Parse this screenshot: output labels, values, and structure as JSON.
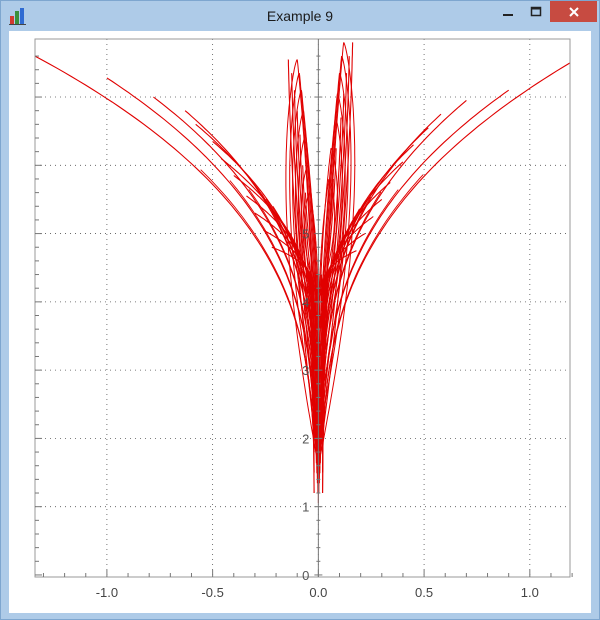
{
  "window": {
    "title": "Example 9",
    "controls": [
      "minimize",
      "maximize",
      "close"
    ],
    "icon": "bar-chart-icon",
    "close_color": "#c74b41",
    "frame_color": "#aecbe8"
  },
  "chart_data": {
    "type": "line",
    "title": "",
    "xlabel": "",
    "ylabel": "",
    "xlim": [
      -1.34,
      1.19
    ],
    "ylim": [
      -0.03,
      7.85
    ],
    "x_ticks": [
      -1.0,
      -0.5,
      0.0,
      0.5,
      1.0
    ],
    "x_tick_labels": [
      "-1.0",
      "-0.5",
      "0.0",
      "0.5",
      "1.0"
    ],
    "y_ticks": [
      0,
      1,
      2,
      3,
      4,
      5
    ],
    "y_tick_labels": [
      "0",
      "1",
      "2",
      "3",
      "4",
      "5"
    ],
    "grid": true,
    "grid_style": "dotted",
    "line_color": "#e00000",
    "curve_family": {
      "outer_branches": [
        {
          "tip": [
            -1.34,
            7.6
          ],
          "base": [
            -0.02,
            1.2
          ]
        },
        {
          "tip": [
            -1.0,
            7.28
          ],
          "base": [
            -0.02,
            1.5
          ]
        },
        {
          "tip": [
            -0.78,
            7.0
          ],
          "base": [
            -0.02,
            1.8
          ]
        },
        {
          "tip": [
            -0.63,
            6.8
          ],
          "base": [
            -0.02,
            2.1
          ]
        },
        {
          "tip": [
            -0.58,
            6.6
          ],
          "base": [
            -0.02,
            2.4
          ]
        },
        {
          "tip": [
            -0.5,
            6.35
          ],
          "base": [
            -0.02,
            2.7
          ]
        },
        {
          "tip": [
            -0.46,
            6.1
          ],
          "base": [
            -0.02,
            3.0
          ]
        },
        {
          "tip": [
            -0.4,
            5.85
          ],
          "base": [
            -0.02,
            3.3
          ]
        },
        {
          "tip": [
            -0.34,
            5.55
          ],
          "base": [
            -0.02,
            3.5
          ]
        },
        {
          "tip": [
            -0.3,
            5.3
          ],
          "base": [
            -0.02,
            3.7
          ]
        },
        {
          "tip": [
            -0.26,
            5.05
          ],
          "base": [
            -0.02,
            3.9
          ]
        },
        {
          "tip": [
            -0.22,
            4.8
          ],
          "base": [
            -0.02,
            4.1
          ]
        },
        {
          "tip": [
            1.19,
            7.5
          ],
          "base": [
            0.02,
            1.2
          ]
        },
        {
          "tip": [
            0.9,
            7.1
          ],
          "base": [
            0.02,
            1.5
          ]
        },
        {
          "tip": [
            0.7,
            6.95
          ],
          "base": [
            0.02,
            1.8
          ]
        },
        {
          "tip": [
            0.58,
            6.75
          ],
          "base": [
            0.02,
            2.1
          ]
        },
        {
          "tip": [
            0.52,
            6.55
          ],
          "base": [
            0.02,
            2.4
          ]
        },
        {
          "tip": [
            0.45,
            6.3
          ],
          "base": [
            0.02,
            2.7
          ]
        },
        {
          "tip": [
            0.4,
            6.05
          ],
          "base": [
            0.02,
            3.0
          ]
        },
        {
          "tip": [
            0.34,
            5.75
          ],
          "base": [
            0.02,
            3.3
          ]
        },
        {
          "tip": [
            0.3,
            5.5
          ],
          "base": [
            0.02,
            3.5
          ]
        },
        {
          "tip": [
            0.26,
            5.25
          ],
          "base": [
            0.02,
            3.7
          ]
        },
        {
          "tip": [
            0.22,
            5.0
          ],
          "base": [
            0.02,
            3.9
          ]
        },
        {
          "tip": [
            0.18,
            4.75
          ],
          "base": [
            0.02,
            4.1
          ]
        }
      ],
      "central_loops": [
        {
          "peak": [
            -0.1,
            7.55
          ],
          "width": 0.14,
          "base": 1.6
        },
        {
          "peak": [
            -0.09,
            7.35
          ],
          "width": 0.12,
          "base": 2.0
        },
        {
          "peak": [
            -0.08,
            7.1
          ],
          "width": 0.11,
          "base": 2.4
        },
        {
          "peak": [
            -0.07,
            6.8
          ],
          "width": 0.1,
          "base": 2.8
        },
        {
          "peak": [
            -0.06,
            6.45
          ],
          "width": 0.09,
          "base": 3.2
        },
        {
          "peak": [
            -0.05,
            6.0
          ],
          "width": 0.08,
          "base": 3.6
        },
        {
          "peak": [
            -0.04,
            5.6
          ],
          "width": 0.07,
          "base": 4.0
        },
        {
          "peak": [
            0.12,
            7.8
          ],
          "width": 0.14,
          "base": 1.6
        },
        {
          "peak": [
            0.11,
            7.6
          ],
          "width": 0.12,
          "base": 2.0
        },
        {
          "peak": [
            0.1,
            7.35
          ],
          "width": 0.11,
          "base": 2.4
        },
        {
          "peak": [
            0.09,
            7.05
          ],
          "width": 0.1,
          "base": 2.8
        },
        {
          "peak": [
            0.08,
            6.7
          ],
          "width": 0.09,
          "base": 3.2
        },
        {
          "peak": [
            0.06,
            6.25
          ],
          "width": 0.08,
          "base": 3.6
        },
        {
          "peak": [
            0.05,
            5.8
          ],
          "width": 0.07,
          "base": 4.0
        }
      ],
      "stem": {
        "x": 0.0,
        "y_range": [
          1.05,
          4.4
        ]
      }
    }
  }
}
